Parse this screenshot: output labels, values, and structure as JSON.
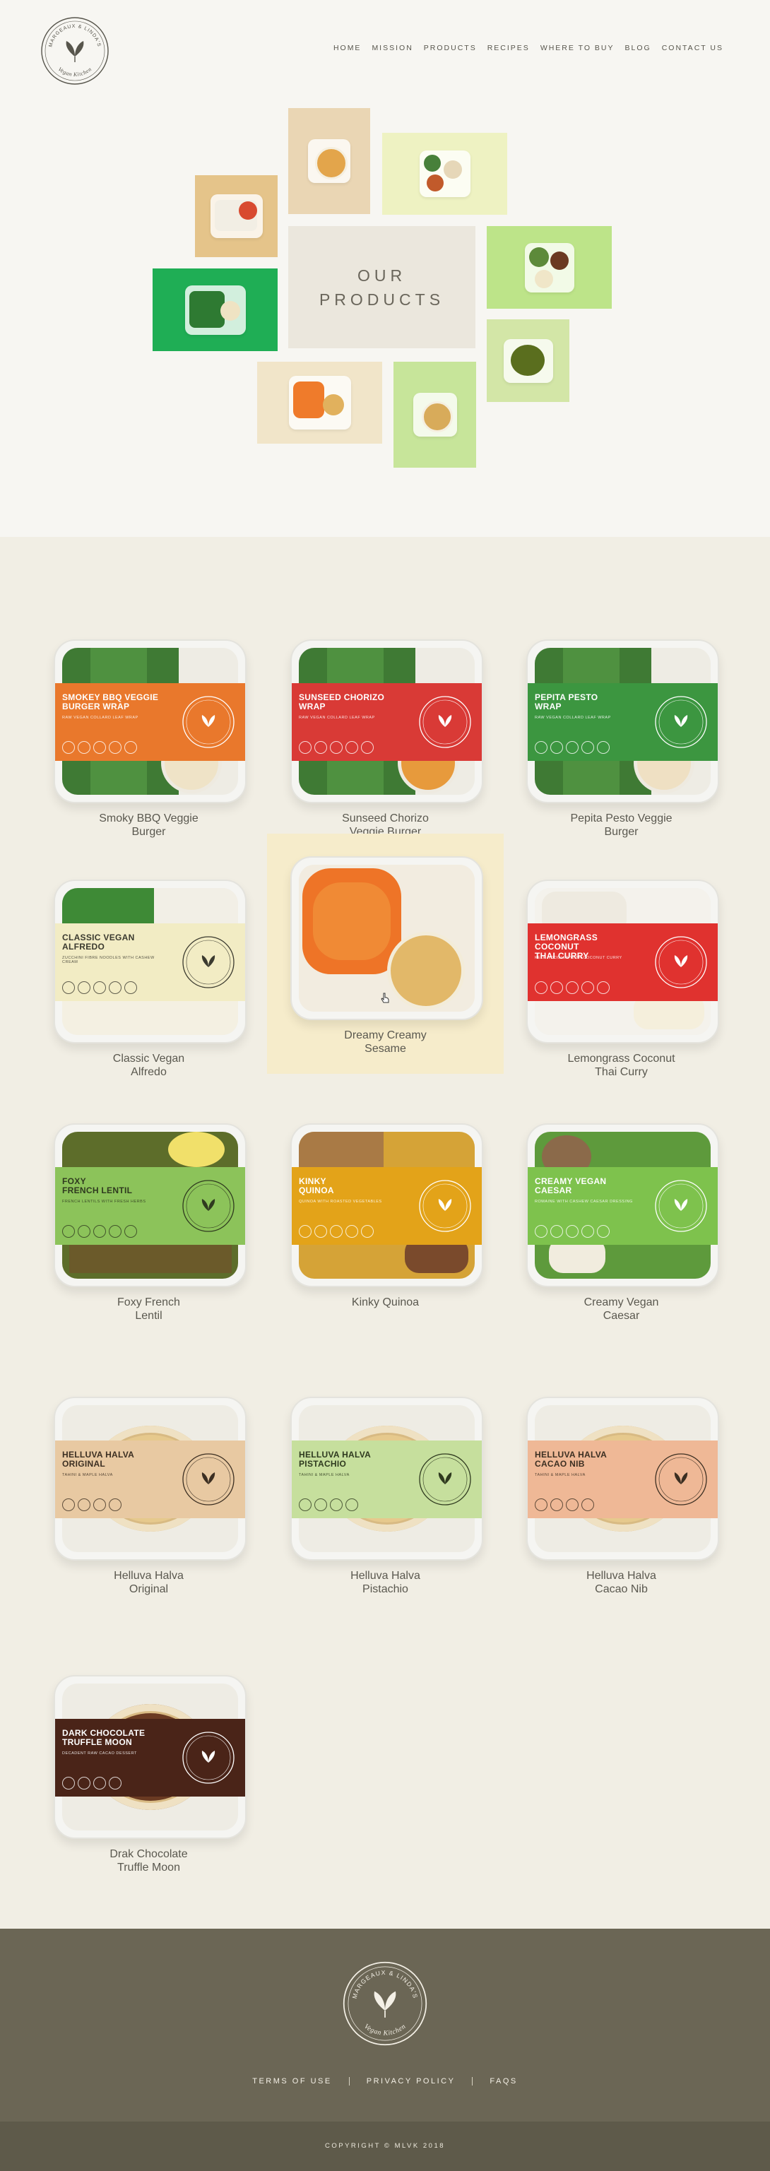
{
  "brand": {
    "logo_top_text": "MARGEAUX & LINDA'S",
    "logo_bottom_text": "Vegan Kitchen"
  },
  "nav": {
    "items": [
      "HOME",
      "MISSION",
      "PRODUCTS",
      "RECIPES",
      "WHERE TO BUY",
      "BLOG",
      "CONTACT US"
    ]
  },
  "hero": {
    "title": "OUR\nPRODUCTS"
  },
  "products": [
    {
      "name": "Smoky BBQ Veggie\nBurger",
      "label_title": "SMOKEY BBQ VEGGIE\nBURGER WRAP",
      "label_sub": "RAW VEGAN COLLARD LEAF WRAP",
      "band_color": "#e9782c",
      "label_text_color": "#ffffff",
      "contents": "wrap"
    },
    {
      "name": "Sunseed Chorizo\nVeggie Burger",
      "label_title": "SUNSEED CHORIZO\nWRAP",
      "label_sub": "RAW VEGAN COLLARD LEAF WRAP",
      "band_color": "#d93a36",
      "label_text_color": "#ffffff",
      "contents": "wrap"
    },
    {
      "name": "Pepita Pesto Veggie\nBurger",
      "label_title": "PEPITA PESTO\nWRAP",
      "label_sub": "RAW VEGAN COLLARD LEAF WRAP",
      "band_color": "#3c9640",
      "label_text_color": "#ffffff",
      "contents": "wrap"
    },
    {
      "name": "Classic Vegan\nAlfredo",
      "label_title": "CLASSIC VEGAN\nALFREDO",
      "label_sub": "ZUCCHINI FIBRE NOODLES WITH CASHEW CREAM",
      "band_color": "#f2ecc4",
      "label_text_color": "#3b3a2f",
      "contents": "noodle"
    },
    {
      "name": "Dreamy Creamy\nSesame",
      "label_title": "",
      "label_sub": "",
      "band_color": "",
      "label_text_color": "#ffffff",
      "contents": "carrot"
    },
    {
      "name": "Lemongrass Coconut\nThai Curry",
      "label_title": "LEMONGRASS COCONUT\nTHAI CURRY",
      "label_sub": "KELP NOODLES WITH COCONUT CURRY",
      "band_color": "#e0322f",
      "label_text_color": "#ffffff",
      "contents": "noodle"
    },
    {
      "name": "Foxy French\nLentil",
      "label_title": "FOXY\nFRENCH LENTIL",
      "label_sub": "FRENCH LENTILS WITH FRESH HERBS",
      "band_color": "#8cc35a",
      "label_text_color": "#2f3a1f",
      "contents": "lentil"
    },
    {
      "name": "Kinky Quinoa",
      "label_title": "KINKY\nQUINOA",
      "label_sub": "QUINOA WITH ROASTED VEGETABLES",
      "band_color": "#e3a319",
      "label_text_color": "#ffffff",
      "contents": "quinoa"
    },
    {
      "name": "Creamy Vegan\nCaesar",
      "label_title": "CREAMY VEGAN\nCAESAR",
      "label_sub": "ROMAINE WITH CASHEW CAESAR DRESSING",
      "band_color": "#7ec24d",
      "label_text_color": "#ffffff",
      "contents": "salad"
    },
    {
      "name": "Helluva Halva\nOriginal",
      "label_title": "HELLUVA HALVA\nORIGINAL",
      "label_sub": "TAHINI & MAPLE HALVA",
      "band_color": "#e8c9a2",
      "label_text_color": "#3c2f22",
      "contents": "muffin"
    },
    {
      "name": "Helluva Halva\nPistachio",
      "label_title": "HELLUVA HALVA\nPISTACHIO",
      "label_sub": "TAHINI & MAPLE HALVA",
      "band_color": "#c6df9d",
      "label_text_color": "#2f3a1f",
      "contents": "muffin"
    },
    {
      "name": "Helluva Halva\nCacao Nib",
      "label_title": "HELLUVA HALVA\nCACAO NIB",
      "label_sub": "TAHINI & MAPLE HALVA",
      "band_color": "#efb896",
      "label_text_color": "#3c2f22",
      "contents": "muffin"
    },
    {
      "name": "Drak Chocolate\nTruffle Moon",
      "label_title": "DARK CHOCOLATE\nTRUFFLE MOON",
      "label_sub": "DECADENT RAW CACAO DESSERT",
      "band_color": "#4a2418",
      "label_text_color": "#ffffff",
      "contents": "muffin"
    }
  ],
  "footer": {
    "links": [
      "TERMS OF USE",
      "PRIVACY POLICY",
      "FAQS"
    ],
    "copyright": "COPYRIGHT © MLVK 2018"
  }
}
